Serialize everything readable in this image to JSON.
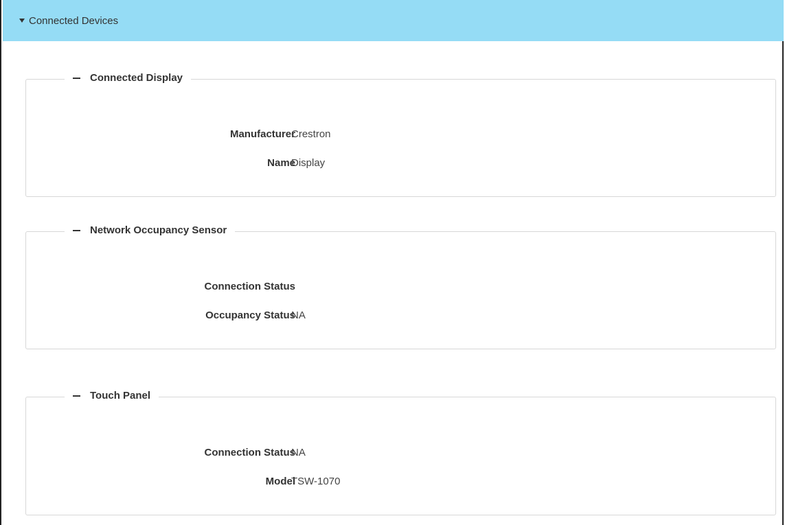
{
  "accordion": {
    "title": "Connected Devices"
  },
  "sections": {
    "display": {
      "title": "Connected Display",
      "rows": [
        {
          "label": "Manufacturer",
          "value": "Crestron"
        },
        {
          "label": "Name",
          "value": "Display"
        }
      ]
    },
    "occupancy": {
      "title": "Network Occupancy Sensor",
      "rows": [
        {
          "label": "Connection Status",
          "value": ""
        },
        {
          "label": "Occupancy Status",
          "value": "NA"
        }
      ]
    },
    "touchpanel": {
      "title": "Touch Panel",
      "rows": [
        {
          "label": "Connection Status",
          "value": "NA"
        },
        {
          "label": "Model",
          "value": "TSW-1070"
        }
      ]
    }
  }
}
